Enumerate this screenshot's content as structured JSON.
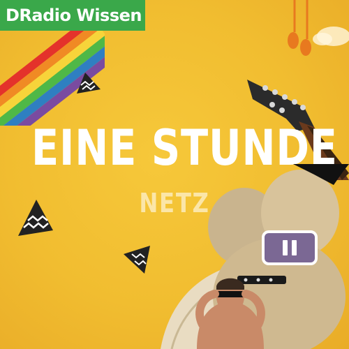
{
  "brand": {
    "label": "DRadio Wissen"
  },
  "program": {
    "title": "EINE STUNDE",
    "subtitle": "NETZ"
  },
  "player": {
    "state": "playing",
    "control_icon": "pause-icon"
  },
  "colors": {
    "background": "#f2be31",
    "brand_bg": "#3aa84a",
    "title_text": "#ffffff",
    "subtitle_text": "#fbe6a8",
    "pause_button_bg": "#7b6894"
  }
}
